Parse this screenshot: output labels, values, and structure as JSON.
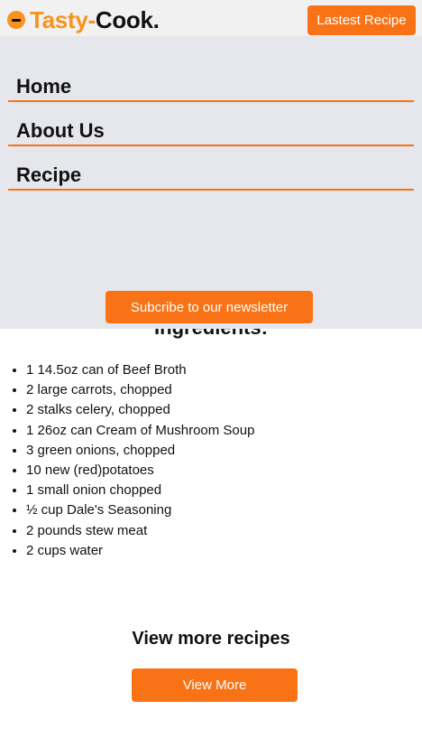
{
  "header": {
    "logo_tasty": "Tasty-",
    "logo_cook": "Cook.",
    "latest_button": "Lastest Recipe"
  },
  "nav": {
    "items": [
      {
        "label": "Home"
      },
      {
        "label": "About Us"
      },
      {
        "label": "Recipe"
      }
    ],
    "subscribe_button": "Subcribe to our newsletter"
  },
  "ingredients": {
    "title": "Ingredients:",
    "items": [
      "1 14.5oz can of Beef Broth",
      "2 large carrots, chopped",
      "2 stalks celery, chopped",
      "1 26oz can Cream of Mushroom Soup",
      "3 green onions, chopped",
      "10 new (red)potatoes",
      "1 small onion chopped",
      "½ cup Dale's Seasoning",
      "2 pounds stew meat",
      "2 cups water"
    ]
  },
  "more": {
    "title": "View more recipes",
    "button": "View More"
  },
  "colors": {
    "accent": "#f97316",
    "logo_orange": "#f7931e",
    "nav_bg": "#e6e7ec",
    "header_bg": "#f1f1f1"
  }
}
